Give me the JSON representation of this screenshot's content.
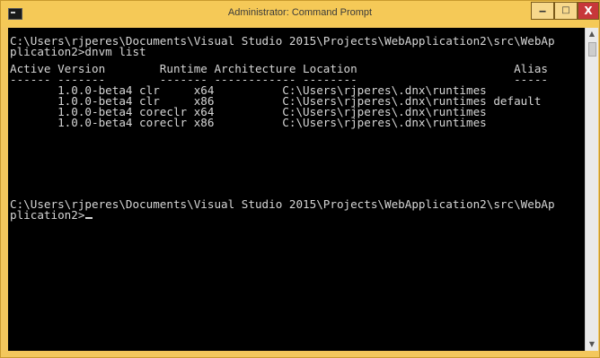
{
  "window": {
    "title": "Administrator: Command Prompt",
    "controls": {
      "minimize": "‒",
      "maximize": "□",
      "close": "X"
    }
  },
  "console": {
    "lines": [
      "C:\\Users\\rjperes\\Documents\\Visual Studio 2015\\Projects\\WebApplication2\\src\\WebAp",
      "plication2>dnvm list",
      "",
      "Active Version        Runtime Architecture Location                       Alias",
      "------ -------        ------- ------------ --------                       -----",
      "       1.0.0-beta4 clr     x64          C:\\Users\\rjperes\\.dnx\\runtimes",
      "       1.0.0-beta4 clr     x86          C:\\Users\\rjperes\\.dnx\\runtimes default",
      "       1.0.0-beta4 coreclr x64          C:\\Users\\rjperes\\.dnx\\runtimes",
      "       1.0.0-beta4 coreclr x86          C:\\Users\\rjperes\\.dnx\\runtimes",
      "",
      "",
      "",
      "C:\\Users\\rjperes\\Documents\\Visual Studio 2015\\Projects\\WebApplication2\\src\\WebAp",
      "plication2>"
    ]
  },
  "scrollbar": {
    "up_icon": "▲",
    "down_icon": "▼"
  }
}
